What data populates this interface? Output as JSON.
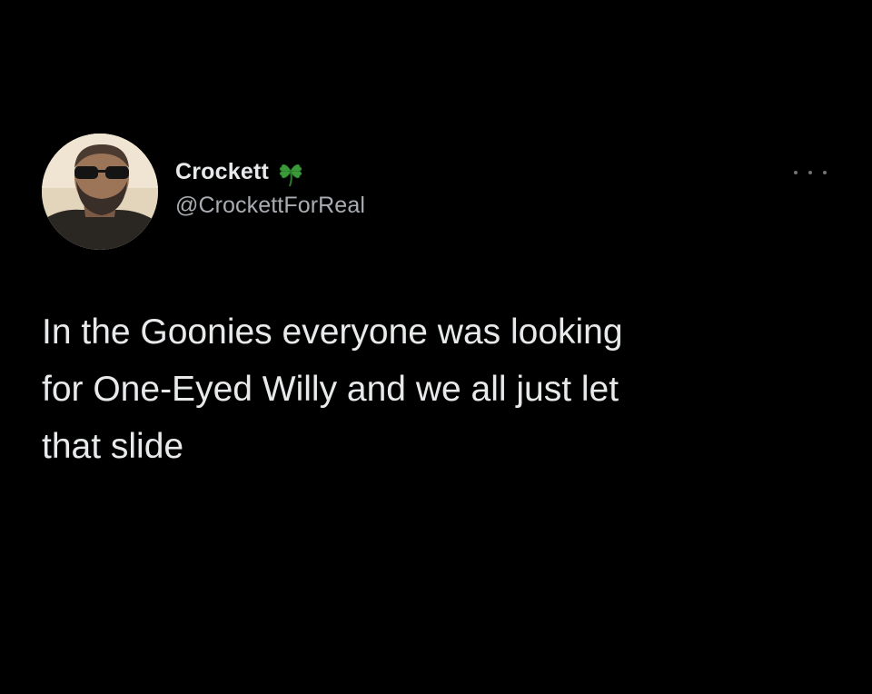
{
  "tweet": {
    "author": {
      "display_name": "Crockett",
      "handle": "@CrockettForReal",
      "name_emoji_icon": "four-leaf-clover-icon",
      "avatar_icon": "profile-photo"
    },
    "more_icon": "ellipsis-icon",
    "text": "In the Goonies everyone was looking\nfor One-Eyed Willy and we all just let\nthat slide"
  },
  "colors": {
    "background": "#000000",
    "primary_text": "#e7e9ea",
    "secondary_text": "#a9adb1",
    "clover_green": "#3a9a3a"
  }
}
